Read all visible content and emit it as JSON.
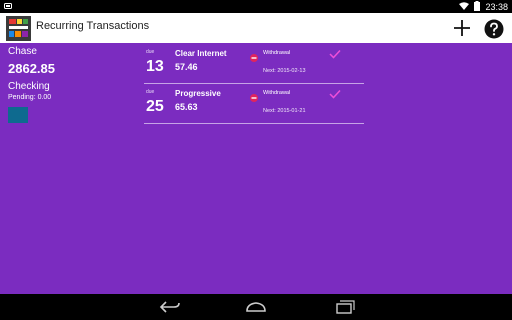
{
  "status_bar": {
    "time": "23:38"
  },
  "action_bar": {
    "title": "Recurring Transactions"
  },
  "account": {
    "bank": "Chase",
    "balance": "2862.85",
    "type": "Checking",
    "pending": "Pending: 0.00",
    "color": "#0e6a8f"
  },
  "transactions": [
    {
      "due_label": "due",
      "day": "13",
      "name": "Clear Internet",
      "amount": "57.46",
      "type": "Withdrawal",
      "next": "Next: 2015-02-13"
    },
    {
      "due_label": "due",
      "day": "25",
      "name": "Progressive",
      "amount": "65.63",
      "type": "Withdrawal",
      "next": "Next: 2015-01-21"
    }
  ],
  "colors": {
    "background": "#7b2cc0",
    "withdrawal": "#e0245e",
    "check": "#ee4fd8"
  }
}
